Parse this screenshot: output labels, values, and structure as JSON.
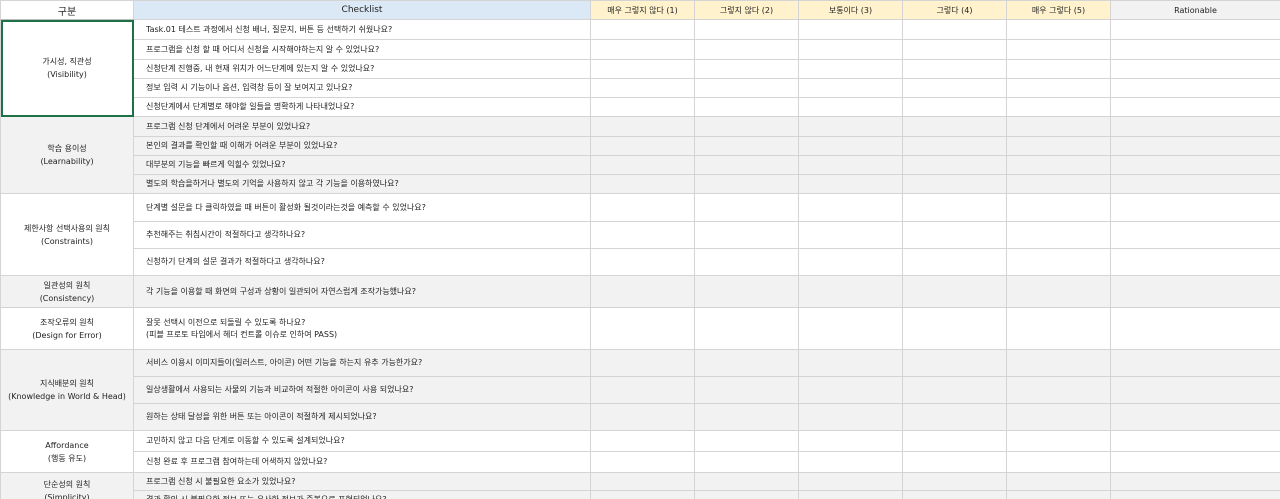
{
  "header": {
    "category": "구분",
    "checklist": "Checklist",
    "scores": [
      "매우 그렇지 않다 (1)",
      "그렇지 않다 (2)",
      "보통이다 (3)",
      "그렇다 (4)",
      "매우 그렇다 (5)"
    ],
    "rationale": "Rationable"
  },
  "groups": [
    {
      "name": "가시성, 직관성",
      "en": "(Visibility)",
      "items": [
        "Task.01 테스트 과정에서 신청 배너, 질문지, 버튼 등 선택하기 쉬웠나요?",
        "프로그램을 신청 할 때 어디서 신청을 시작해야하는지 알 수 있었나요?",
        "신청단계 진행중, 내 현재 위치가 어느단계에 있는지 알 수 있었나요?",
        "정보 입력 시 기능이나 옵션, 입력창 등이 잘 보여지고 있나요?",
        "신청단계에서 단계별로 해야할 일들을 명확하게 나타내었나요?"
      ]
    },
    {
      "name": "학습 용이성",
      "en": "(Learnability)",
      "items": [
        "프로그램 신청 단계에서 어려운 부분이 있었나요?",
        "본인의 결과를 확인할 때 이해가 어려운 부분이 있었나요?",
        "대부분의 기능을 빠르게 익힐수 있었나요?",
        "별도의 학습을하거나 별도의 기억을 사용하지 않고 각 기능을 이용하였나요?"
      ]
    },
    {
      "name": "제한사항 선택사용의 원칙",
      "en": "(Constraints)",
      "items": [
        "단계별 설문을 다 클릭하였을 때 버튼이 활성화 될것이라는것을 예측할 수 있었나요?",
        "추천해주는 취침시간이 적절하다고 생각하나요?",
        "신청하기 단계의 설문 결과가 적절하다고 생각하나요?"
      ]
    },
    {
      "name": "일관성의 원칙",
      "en": "(Consistency)",
      "items": [
        "각 기능을 이용할 때 화면의 구성과 상황이 일관되어 자연스럽게 조작가능했나요?"
      ]
    },
    {
      "name": "조작오류의 원칙",
      "en": "(Design for Error)",
      "items": [
        "잘못 선택시 이전으로 되돌릴 수 있도록 하나요?"
      ],
      "note": "(피블 프로토 타입에서 헤더 컨트롤 이슈로 인하여 PASS)"
    },
    {
      "name": "지식배분의 원칙",
      "en": "(Knowledge in World & Head)",
      "items": [
        "서비스 이용시 이미지들이(일러스트, 아이콘) 어떤 기능을 하는지 유추 가능한가요?",
        "일상생활에서 사용되는 사물의 기능과 비교하여 적절한 아이콘이 사용 되었나요?",
        "원하는 상태 달성을 위한 버튼 또는 아이콘이 적절하게 제시되었나요?"
      ]
    },
    {
      "name": "Affordance",
      "en": "(행동 유도)",
      "items": [
        "고민하지 않고 다음 단계로 이동할 수 있도록 설계되었나요?",
        "신청 완료 후 프로그램 참여하는데 어색하지 않았나요?"
      ]
    },
    {
      "name": "단순성의 원칙",
      "en": "(Simplicity)",
      "items": [
        "프로그램 신청 시 불필요한 요소가 있었나요?",
        "결과 확인 시 불필요한 정보 또는 유사한 정보가 중복으로 표현되었나요?"
      ]
    }
  ]
}
